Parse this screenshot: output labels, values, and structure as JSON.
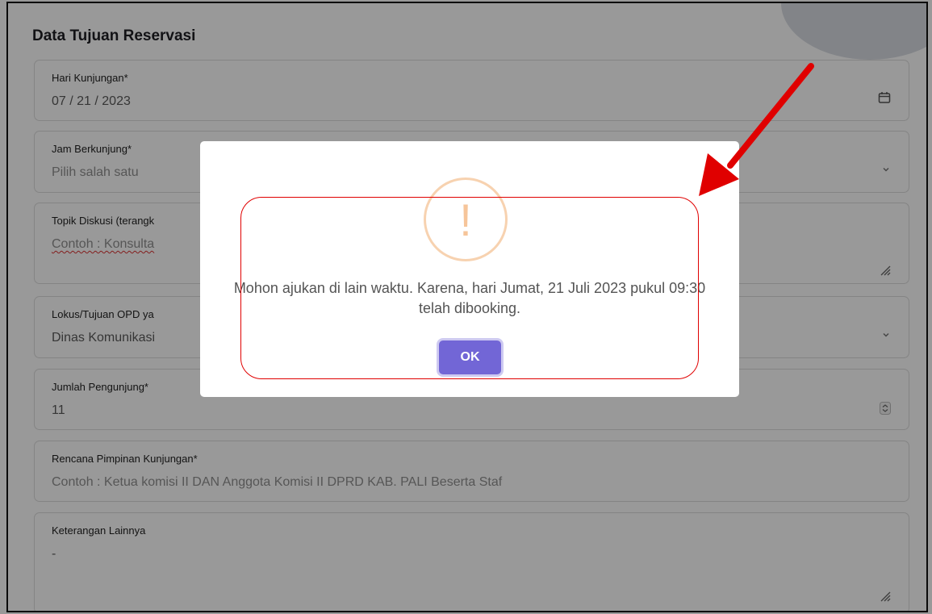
{
  "form": {
    "title": "Data Tujuan Reservasi",
    "fields": [
      {
        "label": "Hari Kunjungan*",
        "value": "07 / 21 / 2023",
        "icon": "calendar-icon"
      },
      {
        "label": "Jam Berkunjung*",
        "placeholder": "Pilih salah satu",
        "icon": "chevron-down-icon"
      },
      {
        "label": "Topik Diskusi (terangk",
        "placeholder": "Contoh : Konsulta",
        "icon": "resize-handle-icon"
      },
      {
        "label": "Lokus/Tujuan OPD ya",
        "value": "Dinas Komunikasi",
        "icon": "chevron-down-icon"
      },
      {
        "label": "Jumlah Pengunjung*",
        "value": "11",
        "icon": "spinner-icon"
      },
      {
        "label": "Rencana Pimpinan Kunjungan*",
        "placeholder": "Contoh : Ketua komisi II DAN Anggota Komisi II DPRD KAB. PALI Beserta Staf"
      },
      {
        "label": "Keterangan Lainnya",
        "value": "-",
        "icon": "resize-handle-icon"
      }
    ]
  },
  "modal": {
    "icon": "warning-icon",
    "icon_glyph": "!",
    "message": "Mohon ajukan di lain waktu. Karena, hari Jumat, 21 Juli 2023 pukul 09:30 telah dibooking.",
    "ok_label": "OK"
  },
  "colors": {
    "accent_button": "#7266d6",
    "annotation_red": "#e00000",
    "warning_orange": "#f6c59a",
    "overlay": "rgba(0,0,0,0.4)"
  }
}
